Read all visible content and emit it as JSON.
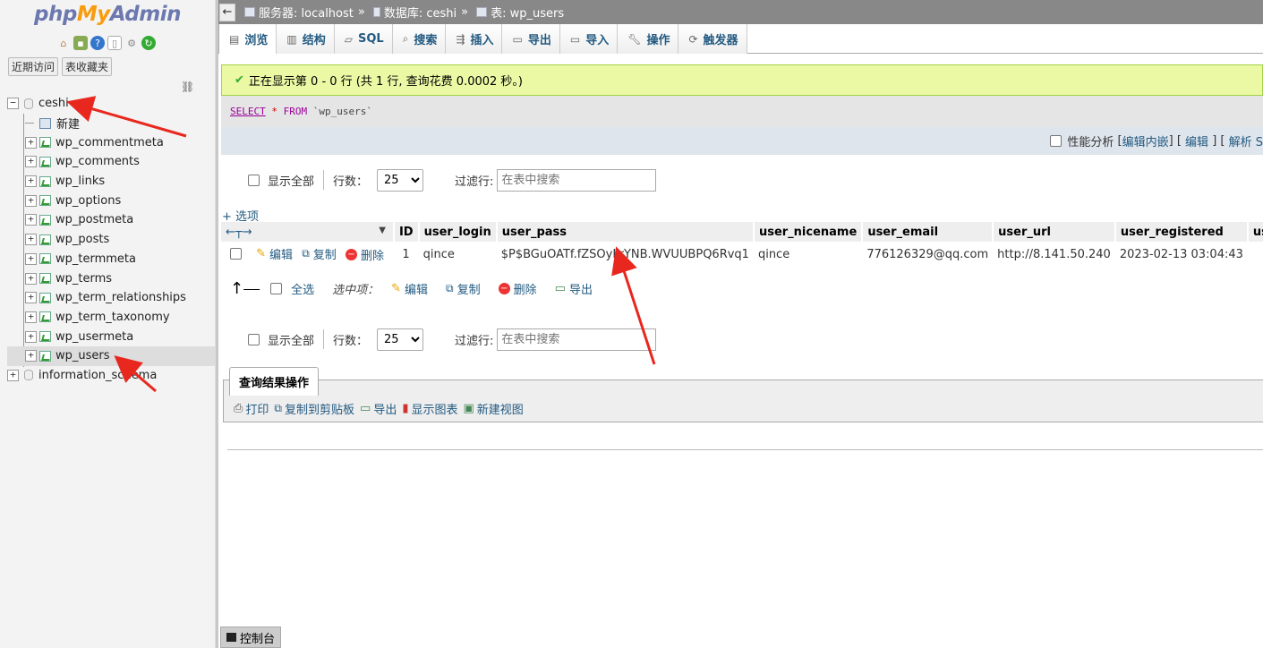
{
  "logo": {
    "php": "php",
    "my": "My",
    "admin": "Admin"
  },
  "left": {
    "recent_label": "近期访问",
    "favorites_label": "表收藏夹",
    "db_ceshi": "ceshi",
    "new_label": "新建",
    "tables": [
      "wp_commentmeta",
      "wp_comments",
      "wp_links",
      "wp_options",
      "wp_postmeta",
      "wp_posts",
      "wp_termmeta",
      "wp_terms",
      "wp_term_relationships",
      "wp_term_taxonomy",
      "wp_usermeta",
      "wp_users"
    ],
    "db_info": "information_schema"
  },
  "breadcrumb": {
    "server": "服务器: localhost",
    "database": "数据库: ceshi",
    "table": "表: wp_users",
    "sep": "»"
  },
  "tabs": [
    "浏览",
    "结构",
    "SQL",
    "搜索",
    "插入",
    "导出",
    "导入",
    "操作",
    "触发器"
  ],
  "success_msg": "正在显示第 0 - 0 行 (共 1 行, 查询花费 0.0002 秒。)",
  "sql": {
    "select": "SELECT",
    "star": "*",
    "from": "FROM",
    "table": "`wp_users`"
  },
  "sqlbar": {
    "profiling": "性能分析",
    "edit_inline": "编辑内嵌",
    "edit": "编辑",
    "explain": "解析 S"
  },
  "nav": {
    "show_all": "显示全部",
    "rows_label": "行数：",
    "rows_value": "25",
    "filter_label": "过滤行:",
    "filter_placeholder": "在表中搜索"
  },
  "options_label": "+ 选项",
  "columns": [
    "ID",
    "user_login",
    "user_pass",
    "user_nicename",
    "user_email",
    "user_url",
    "user_registered",
    "user_a"
  ],
  "row": {
    "edit": "编辑",
    "copy": "复制",
    "delete": "删除",
    "ID": "1",
    "user_login": "qince",
    "user_pass": "$P$BGuOATf.fZSOyLrYNB.WVUUBPQ6Rvq1",
    "user_nicename": "qince",
    "user_email": "776126329@qq.com",
    "user_url": "http://8.141.50.240",
    "user_registered": "2023-02-13 03:04:43"
  },
  "bulk": {
    "select_all": "全选",
    "with_selected": "选中项：",
    "edit": "编辑",
    "copy": "复制",
    "delete": "删除",
    "export": "导出"
  },
  "qro": {
    "title": "查询结果操作",
    "print": "打印",
    "copy_clip": "复制到剪贴板",
    "export": "导出",
    "chart": "显示图表",
    "create_view": "新建视图"
  },
  "console_label": "控制台",
  "colors": {
    "link": "#235a81",
    "success_bg": "#ebf8a4",
    "annotation_arrow": "#e8281e"
  }
}
